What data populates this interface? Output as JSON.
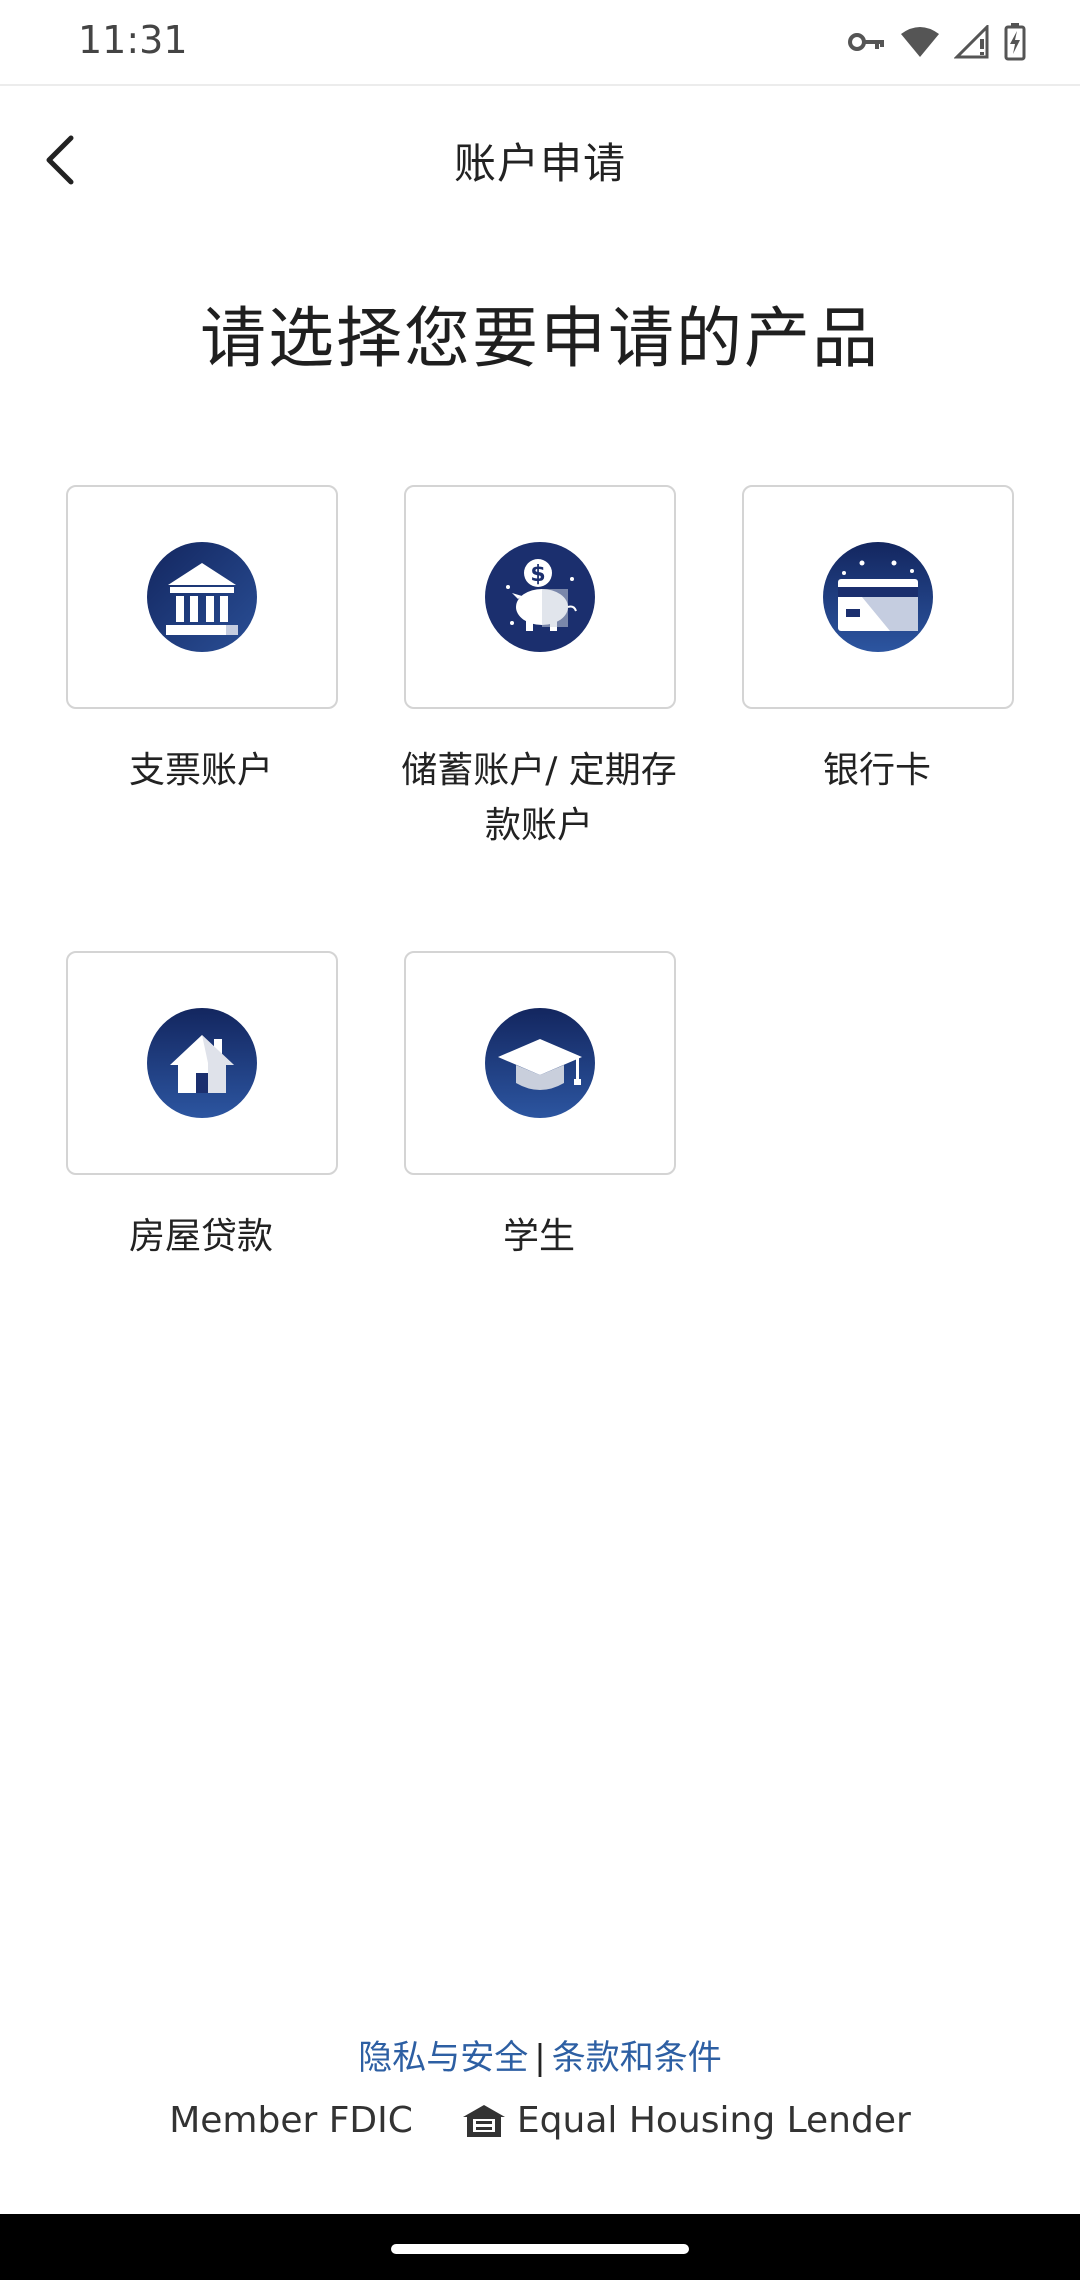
{
  "status_bar": {
    "time": "11:31",
    "icons": [
      "vpn-key-icon",
      "wifi-icon",
      "signal-icon",
      "battery-charging-icon"
    ]
  },
  "header": {
    "back_icon": "chevron-left-icon",
    "title": "账户申请"
  },
  "page": {
    "heading": "请选择您要申请的产品"
  },
  "products": [
    {
      "label": "支票账户",
      "icon": "bank-icon"
    },
    {
      "label": "储蓄账户/ 定期存款账户",
      "icon": "piggy-bank-icon"
    },
    {
      "label": "银行卡",
      "icon": "card-icon"
    },
    {
      "label": "房屋贷款",
      "icon": "house-icon"
    },
    {
      "label": "学生",
      "icon": "graduation-cap-icon"
    }
  ],
  "footer": {
    "privacy_link": "隐私与安全",
    "separator": "|",
    "terms_link": "条款和条件",
    "member_fdic": "Member FDIC",
    "equal_housing": "Equal Housing Lender",
    "equal_housing_icon": "equal-housing-icon"
  },
  "colors": {
    "icon_navy": "#1b2f6e",
    "link_blue": "#2d5fa3",
    "tile_border": "#d4d4d4"
  }
}
